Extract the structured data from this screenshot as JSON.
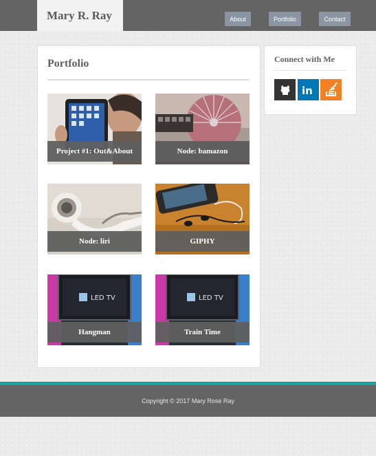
{
  "navbar": {
    "brand": "Mary R. Ray",
    "links": [
      "About",
      "Portfolio",
      "Contact"
    ]
  },
  "portfolio": {
    "title": "Portfolio",
    "projects": [
      {
        "label": "Project #1: Out&About",
        "image": "tablet-person"
      },
      {
        "label": "Node: bamazon",
        "image": "keyboard-fan"
      },
      {
        "label": "Node: liri",
        "image": "earbuds"
      },
      {
        "label": "GIPHY",
        "image": "phone-earphones"
      },
      {
        "label": "Hangman",
        "image": "led-tv"
      },
      {
        "label": "Train Time",
        "image": "led-tv"
      }
    ]
  },
  "connect": {
    "title": "Connect with Me",
    "icons": [
      "github-icon",
      "linkedin-icon",
      "stackoverflow-icon"
    ]
  },
  "footer": {
    "copyright": "Copyright © 2017 Mary Rose Ray"
  },
  "colors": {
    "navbar": "#646464",
    "accent": "#17a2a0",
    "nav_button": "#8a96a3",
    "linkedin": "#0077b5",
    "stackoverflow": "#f48024",
    "github": "#333333"
  }
}
